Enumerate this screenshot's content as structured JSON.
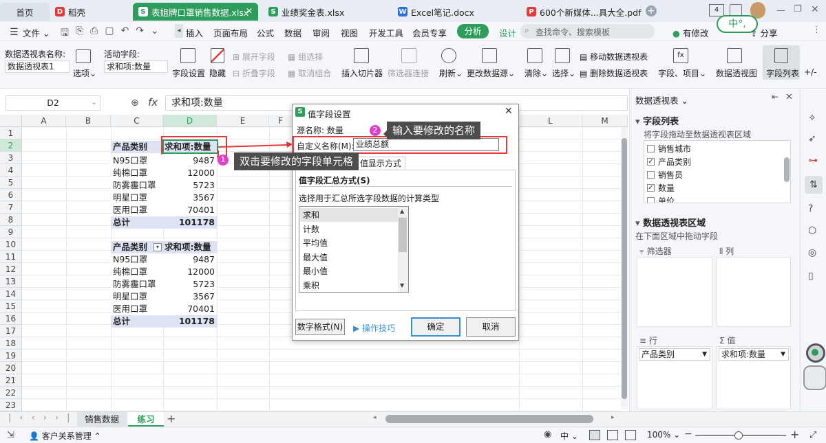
{
  "tabs": {
    "home": "首页",
    "daoke": "稻壳",
    "t1": "表姐牌口罩销售数据.xlsx",
    "t2": "业绩奖金表.xlsx",
    "t3": "Excel笔记.docx",
    "t4": "600个新媒体...具大全.pdf"
  },
  "menubar": {
    "file": "文件",
    "items": [
      "插入",
      "页面布局",
      "公式",
      "数据",
      "审阅",
      "视图",
      "开发工具",
      "会员专享"
    ],
    "analyze": "分析",
    "design": "设计",
    "search_placeholder": "查找命令、搜索模板",
    "modified": "有修改",
    "share": "分享",
    "ime": "中°,"
  },
  "ribbon": {
    "pt_name_label": "数据透视表名称:",
    "pt_name_value": "数据透视表1",
    "options": "选项",
    "active_field_label": "活动字段:",
    "active_field_value": "求和项:数量",
    "field_settings": "字段设置",
    "hide": "隐藏",
    "expand": "展开字段",
    "collapse": "折叠字段",
    "group_sel": "组选择",
    "ungroup": "取消组合",
    "slicer": "插入切片器",
    "filter_conn": "筛选器连接",
    "refresh": "刷新",
    "change_src": "更改数据源",
    "clear": "清除",
    "select": "选择",
    "move_pt": "移动数据透视表",
    "delete_pt": "删除数据透视表",
    "fields_items": "字段、项目",
    "pivot_chart": "数据透视图",
    "field_list": "字段列表",
    "plusminus": "+/-"
  },
  "formula": {
    "cell_ref": "D2",
    "fx": "fx",
    "content": "求和项:数量"
  },
  "columns": [
    "A",
    "B",
    "C",
    "D",
    "E",
    "F",
    "",
    "",
    "",
    "",
    "L",
    "M"
  ],
  "rows": [
    "1",
    "2",
    "3",
    "4",
    "5",
    "6",
    "7",
    "8",
    "9",
    "10",
    "11",
    "12",
    "13",
    "14",
    "15",
    "16",
    "17",
    "18",
    "19",
    "20",
    "21",
    "22",
    "23"
  ],
  "pivot1": {
    "header_cat": "产品类别",
    "header_sum": "求和项:数量",
    "rows": [
      {
        "name": "N95口罩",
        "value": "9487"
      },
      {
        "name": "纯棉口罩",
        "value": "12000"
      },
      {
        "name": "防雾霾口罩",
        "value": "5723"
      },
      {
        "name": "明星口罩",
        "value": "3567"
      },
      {
        "name": "医用口罩",
        "value": "70401"
      }
    ],
    "total_label": "总计",
    "total": "101178"
  },
  "pivot2": {
    "header_cat": "产品类别",
    "header_sum": "求和项:数量",
    "rows": [
      {
        "name": "N95口罩",
        "value": "9487"
      },
      {
        "name": "纯棉口罩",
        "value": "12000"
      },
      {
        "name": "防雾霾口罩",
        "value": "5723"
      },
      {
        "name": "明星口罩",
        "value": "3567"
      },
      {
        "name": "医用口罩",
        "value": "70401"
      }
    ],
    "total_label": "总计",
    "total": "101178"
  },
  "callouts": {
    "c1_num": "1",
    "c1_text": "双击要修改的字段单元格",
    "c2_num": "2",
    "c2_text": "输入要修改的名称"
  },
  "dialog": {
    "title": "值字段设置",
    "source_label": "源名称:",
    "source_value": "数量",
    "custom_label": "自定义名称(M):",
    "custom_value": "业绩总额",
    "tab2": "值显示方式",
    "section": "值字段汇总方式(S)",
    "desc": "选择用于汇总所选字段数据的计算类型",
    "list": [
      "求和",
      "计数",
      "平均值",
      "最大值",
      "最小值",
      "乘积"
    ],
    "numfmt": "数字格式(N)",
    "tips": "操作技巧",
    "ok": "确定",
    "cancel": "取消"
  },
  "panel": {
    "title": "数据透视表",
    "field_list": "字段列表",
    "field_hint": "将字段拖动至数据透视表区域",
    "fields": [
      {
        "name": "销售城市",
        "checked": false
      },
      {
        "name": "产品类别",
        "checked": true
      },
      {
        "name": "销售员",
        "checked": false
      },
      {
        "name": "数量",
        "checked": true
      },
      {
        "name": "单价",
        "checked": false
      }
    ],
    "area_title": "数据透视表区域",
    "area_hint": "在下面区域中拖动字段",
    "filter": "筛选器",
    "col": "列",
    "row": "行",
    "value": "值",
    "row_value": "产品类别",
    "val_value": "求和项:数量"
  },
  "sheets": {
    "s1": "销售数据",
    "s2": "练习"
  },
  "status": {
    "crm": "客户关系管理",
    "ime": "中",
    "zoom": "100%"
  },
  "colors": {
    "accent": "#2e9d5c",
    "callout": "#4d4d4d",
    "badge": "#e040c8",
    "highlight": "#e53935",
    "pivot": "#dde3f3"
  }
}
